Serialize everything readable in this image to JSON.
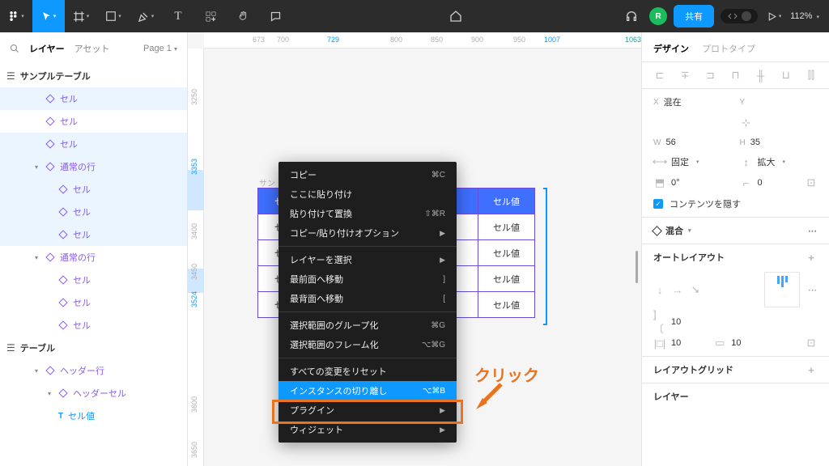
{
  "toolbar": {
    "avatar_letter": "R",
    "share_label": "共有",
    "zoom": "112%"
  },
  "left_panel": {
    "tab_layers": "レイヤー",
    "tab_assets": "アセット",
    "page_selector": "Page 1",
    "items": [
      {
        "type": "frame",
        "label": "サンプルテーブル"
      },
      {
        "type": "comp",
        "label": "セル",
        "lvl": 1,
        "sel": true
      },
      {
        "type": "comp",
        "label": "セル",
        "lvl": 1
      },
      {
        "type": "comp",
        "label": "セル",
        "lvl": 1,
        "sel": true
      },
      {
        "type": "comp",
        "label": "通常の行",
        "lvl": 1,
        "caret": true,
        "sel": true
      },
      {
        "type": "comp",
        "label": "セル",
        "lvl": 2,
        "sel": true
      },
      {
        "type": "comp",
        "label": "セル",
        "lvl": 2,
        "sel": true
      },
      {
        "type": "comp",
        "label": "セル",
        "lvl": 2,
        "sel": true
      },
      {
        "type": "comp",
        "label": "通常の行",
        "lvl": 1,
        "caret": true
      },
      {
        "type": "comp",
        "label": "セル",
        "lvl": 2
      },
      {
        "type": "comp",
        "label": "セル",
        "lvl": 2
      },
      {
        "type": "comp",
        "label": "セル",
        "lvl": 2
      },
      {
        "type": "frame",
        "label": "テーブル"
      },
      {
        "type": "comp",
        "label": "ヘッダー行",
        "lvl": 1,
        "caret": true
      },
      {
        "type": "comp",
        "label": "ヘッダーセル",
        "lvl": 2,
        "caret": true
      },
      {
        "type": "text",
        "label": "セル値",
        "lvl": 2,
        "indent": true
      }
    ]
  },
  "ruler_h": [
    {
      "v": "673",
      "blue": false
    },
    {
      "v": "700"
    },
    {
      "v": "729",
      "blue": true
    },
    {
      "v": "800"
    },
    {
      "v": "850"
    },
    {
      "v": "900"
    },
    {
      "v": "950"
    },
    {
      "v": "1007",
      "blue": true
    },
    {
      "v": "1063",
      "teal": true
    }
  ],
  "ruler_v": [
    "3250",
    "3353",
    "3400",
    "3450",
    "3524",
    "3600",
    "3650"
  ],
  "canvas": {
    "frame_label": "サン",
    "header_cells": [
      "セ",
      "",
      "セル値"
    ],
    "rows": [
      [
        "セ",
        "",
        "セル値"
      ],
      [
        "セ",
        "",
        "セル値"
      ],
      [
        "セ",
        "",
        "セル値"
      ],
      [
        "セ",
        "",
        "セル値"
      ]
    ]
  },
  "context_menu": {
    "copy": "コピー",
    "copy_sc": "⌘C",
    "paste_here": "ここに貼り付け",
    "paste_replace": "貼り付けて置換",
    "paste_replace_sc": "⇧⌘R",
    "copy_paste_opts": "コピー/貼り付けオプション",
    "select_layer": "レイヤーを選択",
    "bring_front": "最前面へ移動",
    "bring_front_sc": "]",
    "send_back": "最背面へ移動",
    "send_back_sc": "[",
    "group": "選択範囲のグループ化",
    "group_sc": "⌘G",
    "frame_sel": "選択範囲のフレーム化",
    "frame_sel_sc": "⌥⌘G",
    "reset": "すべての変更をリセット",
    "detach": "インスタンスの切り離し",
    "detach_sc": "⌥⌘B",
    "plugins": "プラグイン",
    "widgets": "ウィジェット"
  },
  "annotation": {
    "click_text": "クリック"
  },
  "right_panel": {
    "tab_design": "デザイン",
    "tab_proto": "プロトタイプ",
    "x_label": "X",
    "x_val": "混在",
    "y_label": "Y",
    "y_val": "",
    "w_label": "W",
    "w_val": "56",
    "h_label": "H",
    "h_val": "35",
    "hug_label": "固定",
    "grow_label": "拡大",
    "angle_label": "0°",
    "radius_val": "0",
    "hide_content_cb": "コンテンツを隠す",
    "blend_label": "混合",
    "autolayout_label": "オートレイアウト",
    "gap_v": "10",
    "gap_h": "10",
    "gap_h2": "10",
    "layout_grid": "レイアウトグリッド",
    "layer_label": "レイヤー"
  }
}
